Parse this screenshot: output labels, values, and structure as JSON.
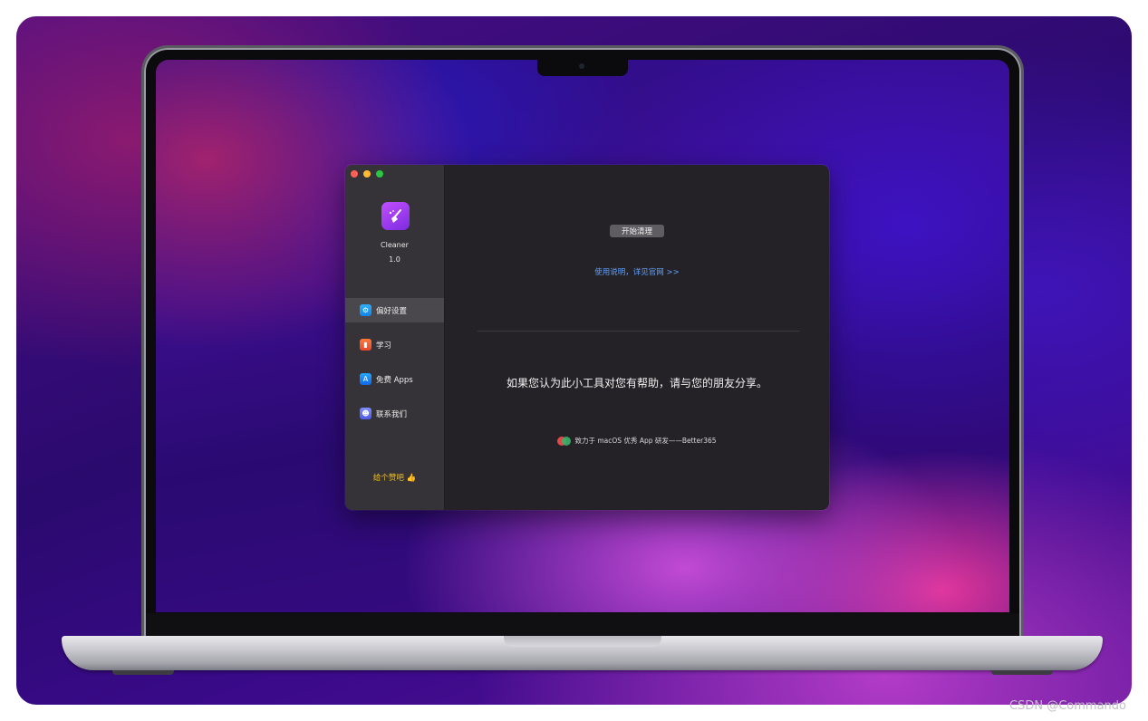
{
  "app": {
    "name": "Cleaner",
    "version": "1.0"
  },
  "sidebar": {
    "items": [
      {
        "label": "偏好设置",
        "icon": "gear-icon",
        "active": true
      },
      {
        "label": "学习",
        "icon": "book-icon",
        "active": false
      },
      {
        "label": "免费 Apps",
        "icon": "app-store-icon",
        "active": false
      },
      {
        "label": "联系我们",
        "icon": "contacts-icon",
        "active": false
      }
    ],
    "rate_label": "给个赞吧 👍"
  },
  "main": {
    "start_button": "开始清理",
    "doc_link": "使用说明，详见官网 >>",
    "share_text": "如果您认为此小工具对您有帮助，请与您的朋友分享。",
    "brand_text": "致力于 macOS 优秀 App 研发——Better365"
  },
  "watermark": "CSDN @Commando",
  "colors": {
    "accent_link": "#5fa2ff",
    "rate_yellow": "#f3c11b",
    "close": "#fe5f57",
    "minimize": "#febc2e",
    "zoom": "#28c840"
  }
}
